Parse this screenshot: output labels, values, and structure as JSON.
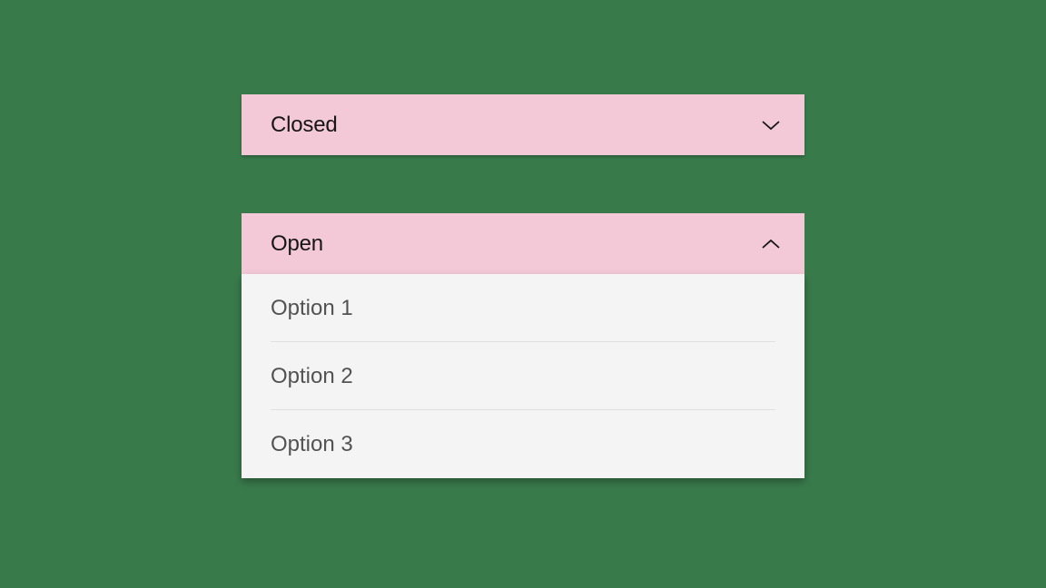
{
  "colors": {
    "background": "#397a4b",
    "header_bg": "#f4c9d7",
    "menu_bg": "#f4f4f4",
    "text_primary": "#161616",
    "text_secondary": "#525252",
    "divider": "#e0e0e0"
  },
  "closed": {
    "label": "Closed"
  },
  "open": {
    "label": "Open",
    "options": [
      {
        "label": "Option 1"
      },
      {
        "label": "Option 2"
      },
      {
        "label": "Option 3"
      }
    ]
  }
}
